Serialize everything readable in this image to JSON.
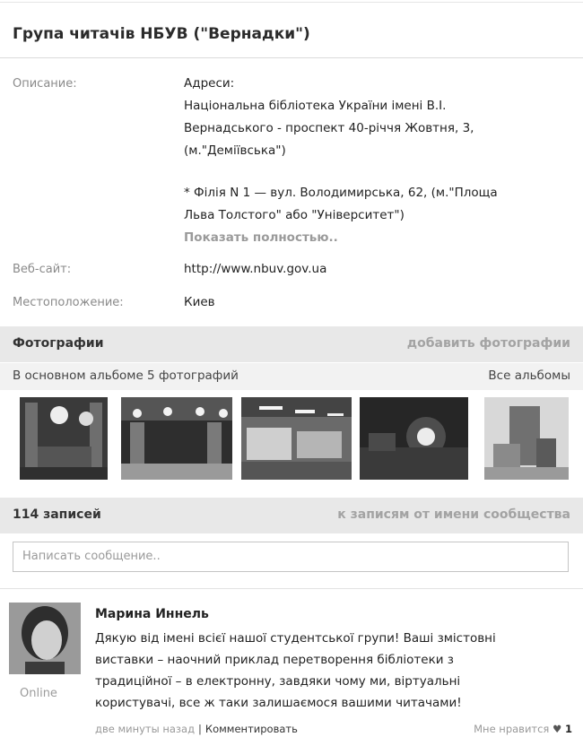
{
  "group_title": "Група читачів НБУВ (\"Вернадки\")",
  "info": {
    "description_label": "Описание:",
    "description_lines": [
      "Адреси:",
      "Національна бібліотека України імені В.І.",
      "Вернадського - проспект 40-річчя Жовтня, 3,",
      "(м.\"Деміївська\")",
      "* Філія N 1 — вул. Володимирська, 62, (м.\"Площа",
      "Льва Толстого\" або \"Університет\")"
    ],
    "show_more": "Показать полностью..",
    "website_label": "Веб-сайт:",
    "website_value": "http://www.nbuv.gov.ua",
    "location_label": "Местоположение:",
    "location_value": "Киев"
  },
  "photos": {
    "header": "Фотографии",
    "add_link": "добавить фотографии",
    "album_info": "В основном альбоме 5 фотографий",
    "all_albums": "Все альбомы"
  },
  "wall": {
    "count_label": "114 записей",
    "community_link": "к записям от имени сообщества",
    "placeholder": "Написать сообщение.."
  },
  "post": {
    "author": "Марина Иннель",
    "text_lines": [
      "Дякую від імені всієї нашої студентської групи! Ваші змістовні",
      "виставки – наочний приклад перетворення бібліотеки з",
      "традиційної – в електронну, завдяки чому ми, віртуальні",
      "користувачі, все ж таки залишаємося вашими читачами!"
    ],
    "status": "Online",
    "time": "две минуты назад",
    "comment": "Комментировать",
    "like_label": "Мне нравится",
    "like_count": "1"
  }
}
